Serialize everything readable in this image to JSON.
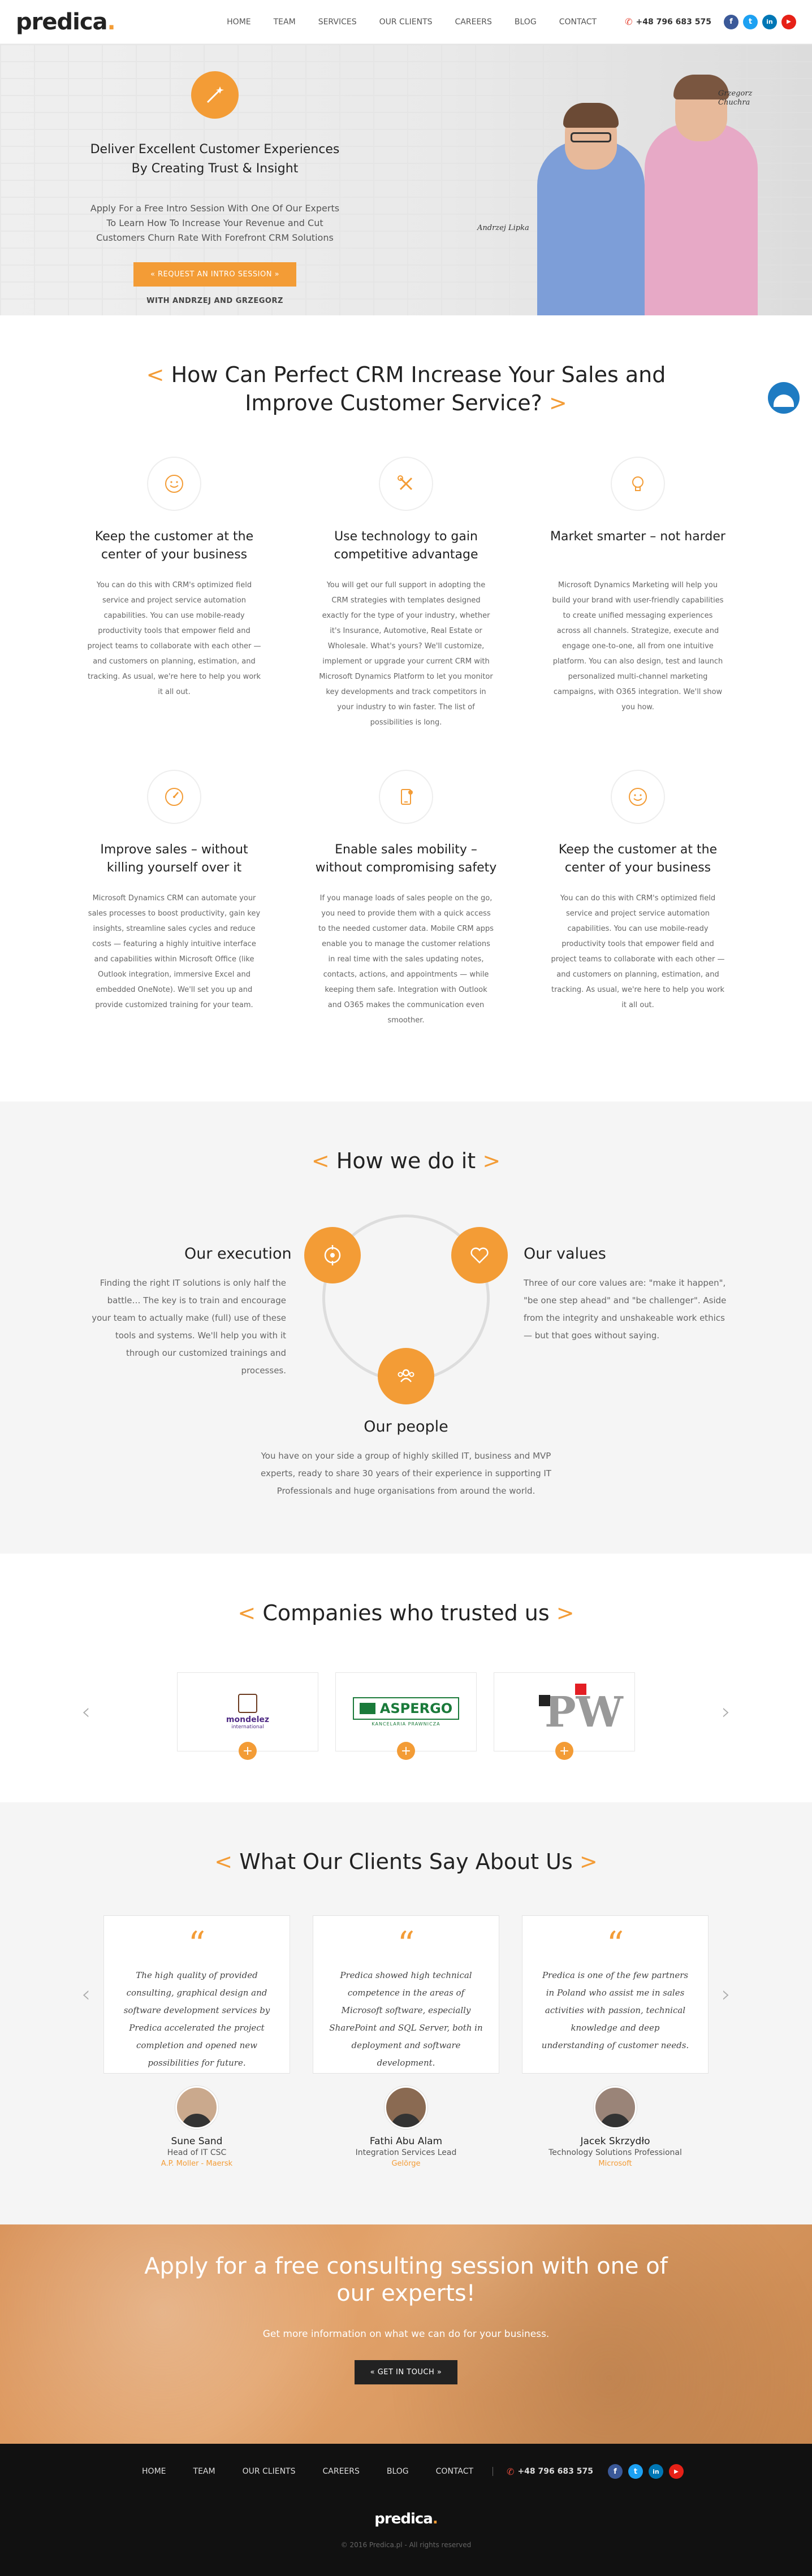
{
  "header": {
    "logo": "predica",
    "logo_dot": ".",
    "nav": [
      "HOME",
      "TEAM",
      "SERVICES",
      "OUR CLIENTS",
      "CAREERS",
      "BLOG",
      "CONTACT"
    ],
    "phone": "+48 796 683 575",
    "socials": [
      {
        "icon": "facebook-icon",
        "glyph": "f",
        "color": "#3b5998"
      },
      {
        "icon": "twitter-icon",
        "glyph": "t",
        "color": "#1da1f2"
      },
      {
        "icon": "linkedin-icon",
        "glyph": "in",
        "color": "#0077b5"
      },
      {
        "icon": "youtube-icon",
        "glyph": "▶",
        "color": "#e62117"
      }
    ]
  },
  "hero": {
    "title": "Deliver Excellent Customer Experiences By Creating Trust & Insight",
    "text": "Apply For a Free Intro Session With One Of Our Experts To Learn How To Increase Your Revenue and Cut Customers Churn Rate With Forefront CRM Solutions",
    "button": "« REQUEST AN INTRO SESSION »",
    "with": "WITH ANDRZEJ AND GRZEGORZ",
    "sig1": "Andrzej Lipka",
    "sig2": "Grzegorz Chuchra"
  },
  "features": {
    "title_open": "<",
    "title": "How Can Perfect CRM Increase Your Sales and Improve Customer Service?",
    "title_close": ">",
    "items": [
      {
        "icon": "smile-icon",
        "title": "Keep the customer at the center of your business",
        "text": "You can do this with CRM's optimized field service and project service automation capabilities. You can use mobile-ready productivity tools that empower field and project teams to collaborate with each other — and customers on planning, estimation, and tracking. As usual, we're here to help you work it all out."
      },
      {
        "icon": "tools-icon",
        "title": "Use technology to gain competitive advantage",
        "text": "You will get our full support in adopting the CRM strategies with templates designed exactly for the type of your industry, whether it's Insurance, Automotive, Real Estate or Wholesale. What's yours? We'll customize, implement or upgrade your current CRM with Microsoft Dynamics Platform to let you monitor key developments and track competitors in your industry to win faster. The list of possibilities is long."
      },
      {
        "icon": "lightbulb-icon",
        "title": "Market smarter – not harder",
        "text": "Microsoft Dynamics Marketing will help you build your brand with user-friendly capabilities to create unified messaging experiences across all channels. Strategize, execute and engage one-to-one, all from one intuitive platform. You can also design, test and launch personalized multi-channel marketing campaigns, with O365 integration. We'll show you how."
      },
      {
        "icon": "gauge-icon",
        "title": "Improve sales – without killing yourself over it",
        "text": "Microsoft Dynamics CRM can automate your sales processes to boost productivity, gain key insights, streamline sales cycles and reduce costs — featuring a highly intuitive interface and capabilities within Microsoft Office (like Outlook integration, immersive Excel and embedded OneNote). We'll set you up and provide customized training for your team."
      },
      {
        "icon": "mobile-icon",
        "title": "Enable sales mobility – without compromising safety",
        "text": "If you manage loads of sales people on the go, you need to provide them with a quick access to the needed customer data. Mobile CRM apps enable you to manage the customer relations in real time with the sales updating notes, contacts, actions, and appointments — while keeping them safe. Integration with Outlook and O365 makes the communication even smoother."
      },
      {
        "icon": "smile-icon",
        "title": "Keep the customer at the center of your business",
        "text": "You can do this with CRM's optimized field service and project service automation capabilities. You can use mobile-ready productivity tools that empower field and project teams to collaborate with each other — and customers on planning, estimation, and tracking. As usual, we're here to help you work it all out."
      }
    ]
  },
  "how": {
    "title": "How we do it",
    "execution_title": "Our execution",
    "execution_text": "Finding the right IT solutions is only half the battle… The key is to train and encourage your team to actually make (full) use of these tools and systems. We'll help you with it through our customized trainings and processes.",
    "values_title": "Our values",
    "values_text": "Three of our core values are: \"make it happen\", \"be one step ahead\" and \"be challenger\". Aside from the integrity and unshakeable work ethics — but that goes without saying.",
    "people_title": "Our people",
    "people_text": "You have on your side a group of highly skilled IT, business and MVP experts, ready to share 30 years of their experience in supporting IT Professionals and huge organisations from around the world."
  },
  "companies": {
    "title": "Companies who trusted us",
    "logos": [
      "mondelez",
      "ASPERGO",
      "PW"
    ],
    "aspergo_sub": "KANCELARIA PRAWNICZA",
    "mondelez_sub": "international"
  },
  "testimonials": {
    "title": "What Our Clients Say About Us",
    "items": [
      {
        "quote": "The high quality of provided consulting, graphical design and software development services by Predica accelerated the project completion and opened new possibilities for future.",
        "name": "Sune Sand",
        "role": "Head of IT CSC",
        "company": "A.P. Moller - Maersk"
      },
      {
        "quote": "Predica showed high technical competence in the areas of Microsoft software, especially SharePoint and SQL Server, both in deployment and software development.",
        "name": "Fathi Abu Alam",
        "role": "Integration Services Lead",
        "company": "Gelörge"
      },
      {
        "quote": "Predica is one of the few partners in Poland who assist me in sales activities with passion, technical knowledge and deep understanding of customer needs.",
        "name": "Jacek Skrzydło",
        "role": "Technology Solutions Professional",
        "company": "Microsoft"
      }
    ]
  },
  "cta": {
    "title": "Apply for a free consulting session with one of our experts!",
    "text": "Get more information on what we can do for your business.",
    "button": "« GET IN TOUCH »"
  },
  "footer": {
    "nav": [
      "HOME",
      "TEAM",
      "OUR CLIENTS",
      "CAREERS",
      "BLOG",
      "CONTACT"
    ],
    "phone": "+48 796 683 575",
    "logo": "predica",
    "logo_dot": ".",
    "copyright": "© 2016 Predica.pl - All rights reserved"
  },
  "colors": {
    "accent": "#f39c36",
    "dark": "#111111",
    "chat": "#1e7bc2"
  }
}
